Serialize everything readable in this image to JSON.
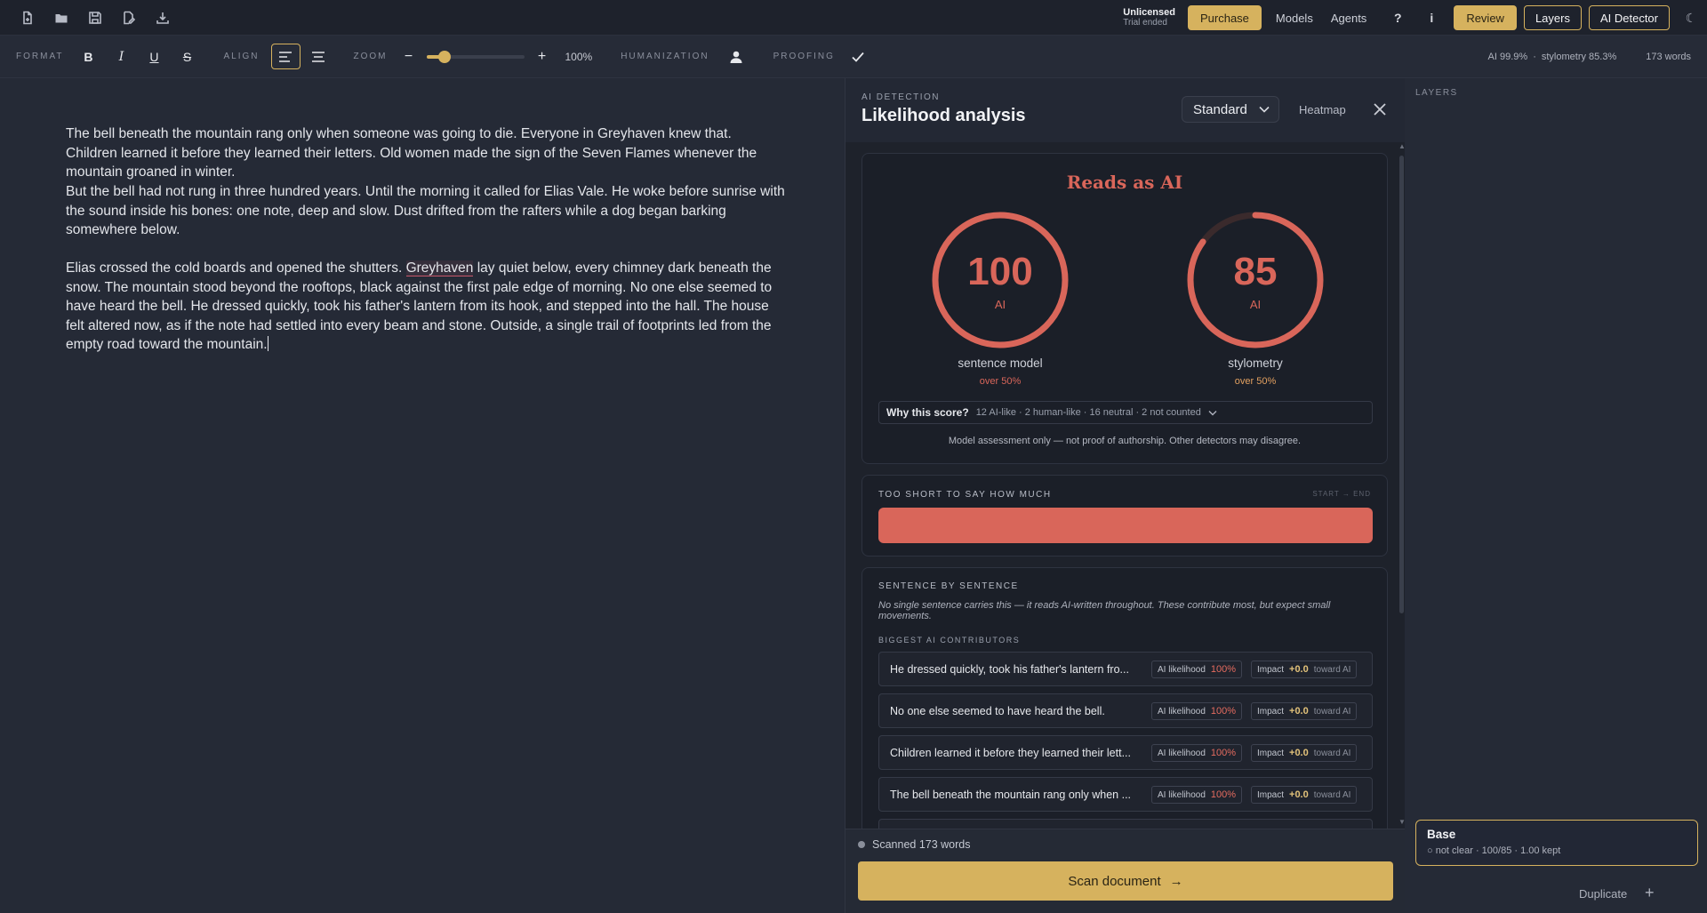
{
  "topbar": {
    "license_title": "Unlicensed",
    "license_sub": "Trial ended",
    "purchase": "Purchase",
    "models": "Models",
    "agents": "Agents",
    "help": "?",
    "info": "i",
    "review": "Review",
    "layers": "Layers",
    "ai_detector": "AI Detector",
    "moon": "☾"
  },
  "toolbar": {
    "format_label": "FORMAT",
    "bold": "B",
    "italic": "I",
    "underline": "U",
    "strike": "S",
    "align_label": "ALIGN",
    "zoom_label": "ZOOM",
    "zoom_minus": "−",
    "zoom_plus": "+",
    "zoom_value": "100%",
    "zoom_level": 0.19,
    "humanization_label": "HUMANIZATION",
    "proofing_label": "PROOFING",
    "stat_ai": "AI 99.9%",
    "stat_sep": "·",
    "stat_stylo": "stylometry 85.3%",
    "stat_words": "173 words"
  },
  "editor": {
    "p1": "The bell beneath the mountain rang only when someone was going to die. Everyone in Greyhaven knew that. Children learned it before they learned their letters. Old women made the sign of the Seven Flames whenever the mountain groaned in winter.",
    "p2": "But the bell had not rung in three hundred years. Until the morning it called for Elias Vale. He woke before sunrise with the sound inside his bones: one note, deep and slow. Dust drifted from the rafters while a dog began barking somewhere below.",
    "p3_before": "Elias crossed the cold boards and opened the shutters. ",
    "p3_highlight": "Greyhaven",
    "p3_after": " lay quiet below, every chimney dark beneath the snow. The mountain stood beyond the rooftops, black against the first pale edge of morning. No one else seemed to have heard the bell. He dressed quickly, took his father's lantern from its hook, and stepped into the hall. The house felt altered now, as if the note had settled into every beam and stone. Outside, a single trail of footprints led from the empty road toward the mountain."
  },
  "panel": {
    "kicker": "AI DETECTION",
    "title": "Likelihood analysis",
    "mode": "Standard",
    "heatmap": "Heatmap",
    "verdict": "Reads as AI",
    "gauges": [
      {
        "value": "100",
        "unit": "AI",
        "label": "sentence model",
        "sub": "over 50%",
        "fraction": 1.0,
        "sub_color": "#d9665a"
      },
      {
        "value": "85",
        "unit": "AI",
        "label": "stylometry",
        "sub": "over 50%",
        "fraction": 0.85,
        "sub_color": "#e2a060"
      }
    ],
    "why_label": "Why this score?",
    "why_detail": "12 AI-like · 2 human-like · 16 neutral · 2 not counted",
    "disclaimer": "Model assessment only — not proof of authorship. Other detectors may disagree.",
    "short_title": "TOO SHORT TO SAY HOW MUCH",
    "short_right": "START → END",
    "sentence_title": "SENTENCE BY SENTENCE",
    "sentence_note": "No single sentence carries this — it reads AI-written throughout. These contribute most, but expect small movements.",
    "contributors_title": "BIGGEST AI CONTRIBUTORS",
    "rows": [
      {
        "text": "He dressed quickly, took his father's lantern fro...",
        "lik_label": "AI likelihood",
        "lik": "100%",
        "imp_label": "Impact",
        "imp": "+0.0",
        "dir": "toward AI"
      },
      {
        "text": "No one else seemed to have heard the bell.",
        "lik_label": "AI likelihood",
        "lik": "100%",
        "imp_label": "Impact",
        "imp": "+0.0",
        "dir": "toward AI"
      },
      {
        "text": "Children learned it before they learned their lett...",
        "lik_label": "AI likelihood",
        "lik": "100%",
        "imp_label": "Impact",
        "imp": "+0.0",
        "dir": "toward AI"
      },
      {
        "text": "The bell beneath the mountain rang only when ...",
        "lik_label": "AI likelihood",
        "lik": "100%",
        "imp_label": "Impact",
        "imp": "+0.0",
        "dir": "toward AI"
      }
    ],
    "scanned": "Scanned 173 words",
    "scan_button": "Scan document",
    "scan_arrow": "→"
  },
  "layers": {
    "title": "LAYERS",
    "base_name": "Base",
    "base_meta": "○ not clear  ·  100/85  ·  1.00 kept",
    "duplicate": "Duplicate",
    "plus": "+"
  },
  "colors": {
    "accent": "#d6b25e",
    "ai_red": "#d9665a"
  }
}
